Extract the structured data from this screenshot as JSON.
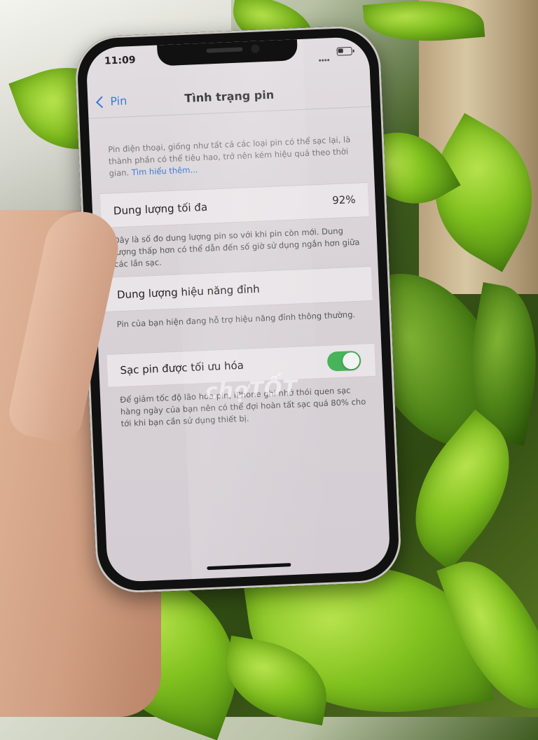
{
  "status_bar": {
    "time": "11:09"
  },
  "nav": {
    "back_label": "Pin",
    "title": "Tình trạng pin"
  },
  "intro": {
    "text": "Pin điện thoại, giống như tất cả các loại pin có thể sạc lại, là thành phần có thể tiêu hao, trở nên kém hiệu quả theo thời gian.",
    "link": "Tìm hiểu thêm..."
  },
  "max_capacity": {
    "label": "Dung lượng tối đa",
    "value": "92%",
    "note": "Đây là số đo dung lượng pin so với khi pin còn mới. Dung lượng thấp hơn có thể dẫn đến số giờ sử dụng ngắn hơn giữa các lần sạc."
  },
  "peak_performance": {
    "label": "Dung lượng hiệu năng đỉnh",
    "note": "Pin của bạn hiện đang hỗ trợ hiệu năng đỉnh thông thường."
  },
  "optimized_charging": {
    "label": "Sạc pin được tối ưu hóa",
    "enabled": true,
    "note": "Để giảm tốc độ lão hóa pin, iPhone ghi nhớ thói quen sạc hàng ngày của bạn nên có thể đợi hoàn tất sạc quá 80% cho tới khi bạn cần sử dụng thiết bị."
  },
  "watermark": "chợTỐT",
  "colors": {
    "accent": "#3a7bd5",
    "toggle_on": "#47b35a"
  }
}
